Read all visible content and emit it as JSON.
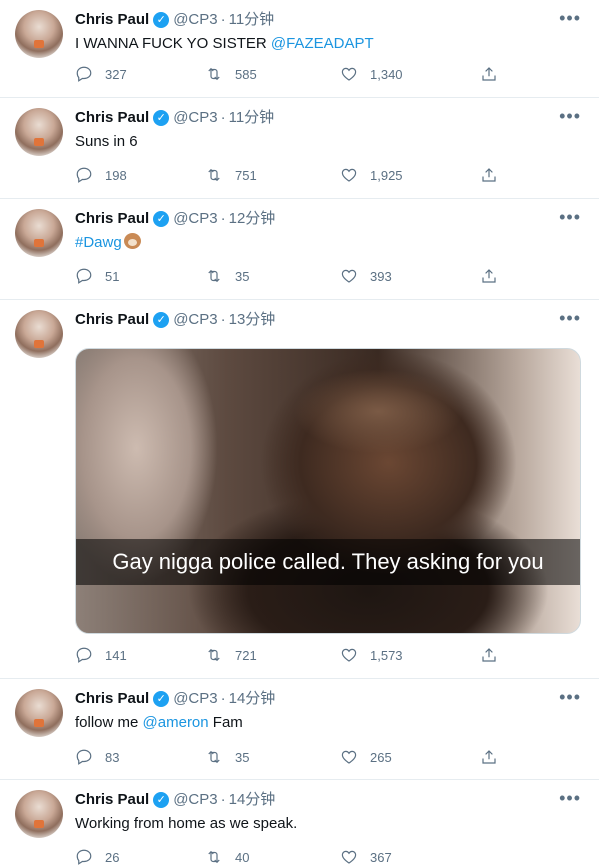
{
  "tweets": [
    {
      "name": "Chris Paul",
      "handle": "@CP3",
      "sep": "·",
      "time": "11分钟",
      "text": "I WANNA FUCK YO SISTER ",
      "mention": "@FAZEADAPT",
      "text_after": "",
      "replies": "327",
      "retweets": "585",
      "likes": "1,340"
    },
    {
      "name": "Chris Paul",
      "handle": "@CP3",
      "sep": "·",
      "time": "11分钟",
      "text": "Suns in 6",
      "mention": "",
      "text_after": "",
      "replies": "198",
      "retweets": "751",
      "likes": "1,925"
    },
    {
      "name": "Chris Paul",
      "handle": "@CP3",
      "sep": "·",
      "time": "12分钟",
      "text": "",
      "mention": "#Dawg",
      "text_after": "",
      "replies": "51",
      "retweets": "35",
      "likes": "393"
    },
    {
      "name": "Chris Paul",
      "handle": "@CP3",
      "sep": "·",
      "time": "13分钟",
      "media_caption": "Gay nigga police called. They asking for you",
      "replies": "141",
      "retweets": "721",
      "likes": "1,573"
    },
    {
      "name": "Chris Paul",
      "handle": "@CP3",
      "sep": "·",
      "time": "14分钟",
      "text": "follow me ",
      "mention": "@ameron",
      "text_after": " Fam",
      "replies": "83",
      "retweets": "35",
      "likes": "265"
    },
    {
      "name": "Chris Paul",
      "handle": "@CP3",
      "sep": "·",
      "time": "14分钟",
      "text": "Working from home as we speak.",
      "mention": "",
      "text_after": "",
      "replies": "26",
      "retweets": "40",
      "likes": "367"
    }
  ],
  "icons": {
    "verified": "verified-badge-icon",
    "more": "more-icon",
    "reply": "reply-icon",
    "retweet": "retweet-icon",
    "like": "like-icon",
    "share": "share-icon",
    "emoji": "dog-emoji-icon"
  },
  "colors": {
    "link": "#1b95e0",
    "verified": "#1da1f2",
    "muted": "#5b7083"
  }
}
